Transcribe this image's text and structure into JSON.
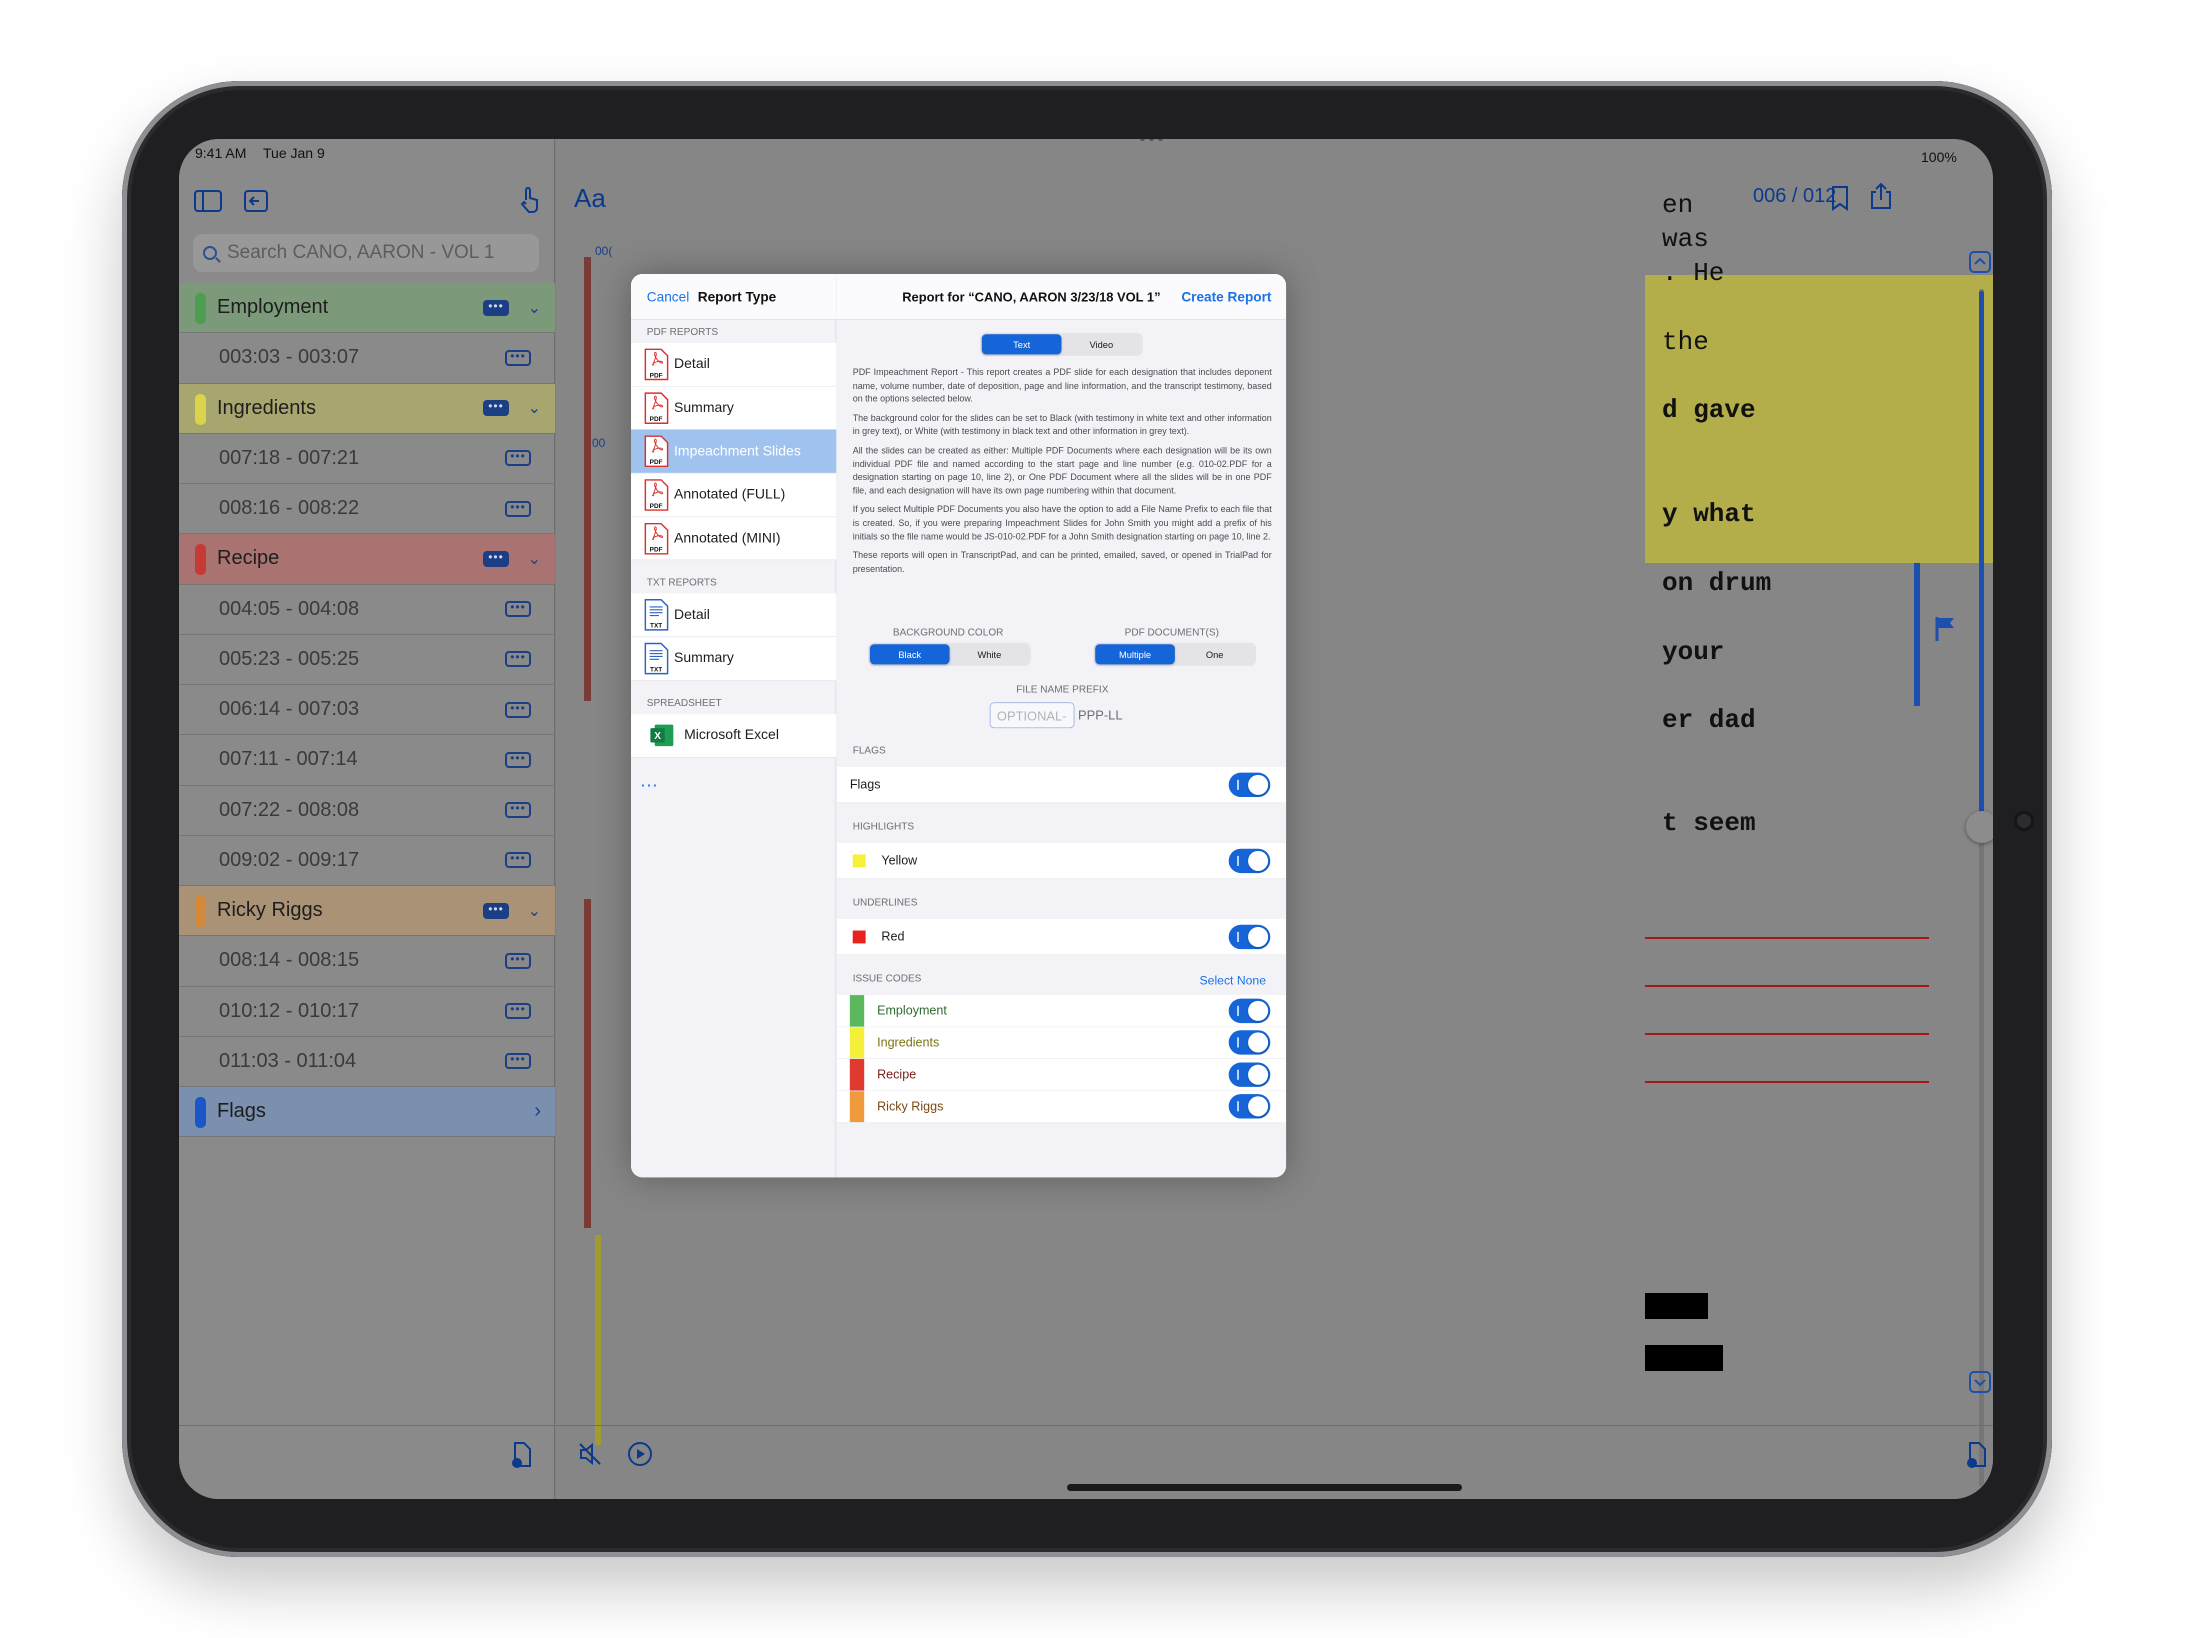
{
  "status": {
    "time": "9:41 AM",
    "date": "Tue Jan 9",
    "battery": "100%"
  },
  "sidebar": {
    "search_placeholder": "Search CANO, AARON - VOL 1",
    "designations": [
      {
        "kind": "group",
        "label": "Employment",
        "color": "#4e9e52"
      },
      {
        "kind": "item",
        "label": "003:03 - 003:07"
      },
      {
        "kind": "group",
        "label": "Ingredients",
        "color": "#d9d44c"
      },
      {
        "kind": "item",
        "label": "007:18 - 007:21"
      },
      {
        "kind": "item",
        "label": "008:16 - 008:22"
      },
      {
        "kind": "group",
        "label": "Recipe",
        "color": "#c53a33"
      },
      {
        "kind": "item",
        "label": "004:05 - 004:08"
      },
      {
        "kind": "item",
        "label": "005:23 - 005:25"
      },
      {
        "kind": "item",
        "label": "006:14 - 007:03"
      },
      {
        "kind": "item",
        "label": "007:11 - 007:14"
      },
      {
        "kind": "item",
        "label": "007:22 - 008:08"
      },
      {
        "kind": "item",
        "label": "009:02 - 009:17"
      },
      {
        "kind": "group",
        "label": "Ricky Riggs",
        "color": "#d48a3b"
      },
      {
        "kind": "item",
        "label": "008:14 - 008:15"
      },
      {
        "kind": "item",
        "label": "010:12 - 010:17"
      },
      {
        "kind": "item",
        "label": "011:03 - 011:04"
      },
      {
        "kind": "flags",
        "label": "Flags",
        "color": "#1a56c8"
      }
    ]
  },
  "toolbar": {
    "aa": "Aa",
    "page": "006 / 012"
  },
  "transcript_fragments": [
    "en",
    "was",
    ". He",
    "the",
    "d gave",
    "y what",
    "on drum",
    "your",
    "er dad",
    "t seem"
  ],
  "side_numbers": [
    "00(",
    "00"
  ],
  "sheet": {
    "cancel": "Cancel",
    "left_title": "Report Type",
    "right_title": "Report for “CANO, AARON 3/23/18 VOL 1”",
    "create": "Create Report",
    "sections": [
      {
        "header": "PDF REPORTS",
        "items": [
          {
            "label": "Detail",
            "icon": "PDF"
          },
          {
            "label": "Summary",
            "icon": "PDF"
          },
          {
            "label": "Impeachment Slides",
            "icon": "PDF",
            "selected": true
          },
          {
            "label": "Annotated (FULL)",
            "icon": "PDF"
          },
          {
            "label": "Annotated (MINI)",
            "icon": "PDF"
          }
        ]
      },
      {
        "header": "TXT REPORTS",
        "items": [
          {
            "label": "Detail",
            "icon": "TXT"
          },
          {
            "label": "Summary",
            "icon": "TXT"
          }
        ]
      },
      {
        "header": "SPREADSHEET",
        "items": [
          {
            "label": "Microsoft Excel",
            "icon": "XLS"
          }
        ]
      }
    ],
    "more": "…",
    "seg_output": {
      "options": [
        "Text",
        "Video"
      ],
      "selected": "Text"
    },
    "description": [
      "PDF Impeachment Report - This report creates a PDF slide for each designation that includes deponent name, volume number, date of deposition, page and line information, and the transcript testimony, based on the options selected below.",
      "The background color for the slides can be set to Black (with testimony in white text and other information in grey text), or White (with testimony in black text and other information in grey text).",
      "All the slides can be created as either: Multiple PDF Documents where each designation will be its own individual PDF file and named according to the start page and line number (e.g. 010-02.PDF for a designation starting on page 10, line 2), or One PDF Document where all the slides will be in one PDF file, and each designation will have its own page numbering within that document.",
      "If you select Multiple PDF Documents you also have the option to add a File Name Prefix to each file that is created. So, if you were preparing Impeachment Slides for John Smith you might add a prefix of his initials so the file name would be JS-010-02.PDF for a John Smith designation starting on page 10, line 2.",
      "These reports will open in TranscriptPad, and can be printed, emailed, saved, or opened in TrialPad for presentation."
    ],
    "bg_color": {
      "label": "BACKGROUND COLOR",
      "options": [
        "Black",
        "White"
      ],
      "selected": "Black"
    },
    "pdf_docs": {
      "label": "PDF DOCUMENT(S)",
      "options": [
        "Multiple",
        "One"
      ],
      "selected": "Multiple"
    },
    "prefix": {
      "label": "FILE NAME PREFIX",
      "placeholder": "OPTIONAL-",
      "suffix": "PPP-LL"
    },
    "flags": {
      "header": "FLAGS",
      "label": "Flags",
      "on": true
    },
    "highlights": {
      "header": "HIGHLIGHTS",
      "label": "Yellow",
      "color": "#f7f03a",
      "on": true
    },
    "underlines": {
      "header": "UNDERLINES",
      "label": "Red",
      "color": "#e8231b",
      "on": true
    },
    "issue_codes": {
      "header": "ISSUE CODES",
      "select_none": "Select None",
      "items": [
        {
          "label": "Employment",
          "color": "#5cb85c",
          "text_color": "#2f6b31",
          "on": true
        },
        {
          "label": "Ingredients",
          "color": "#f5ef3a",
          "text_color": "#7b7314",
          "on": true
        },
        {
          "label": "Recipe",
          "color": "#e0392f",
          "text_color": "#7b1d16",
          "on": true
        },
        {
          "label": "Ricky Riggs",
          "color": "#ef9a3c",
          "text_color": "#7a4a14",
          "on": true
        }
      ]
    }
  }
}
